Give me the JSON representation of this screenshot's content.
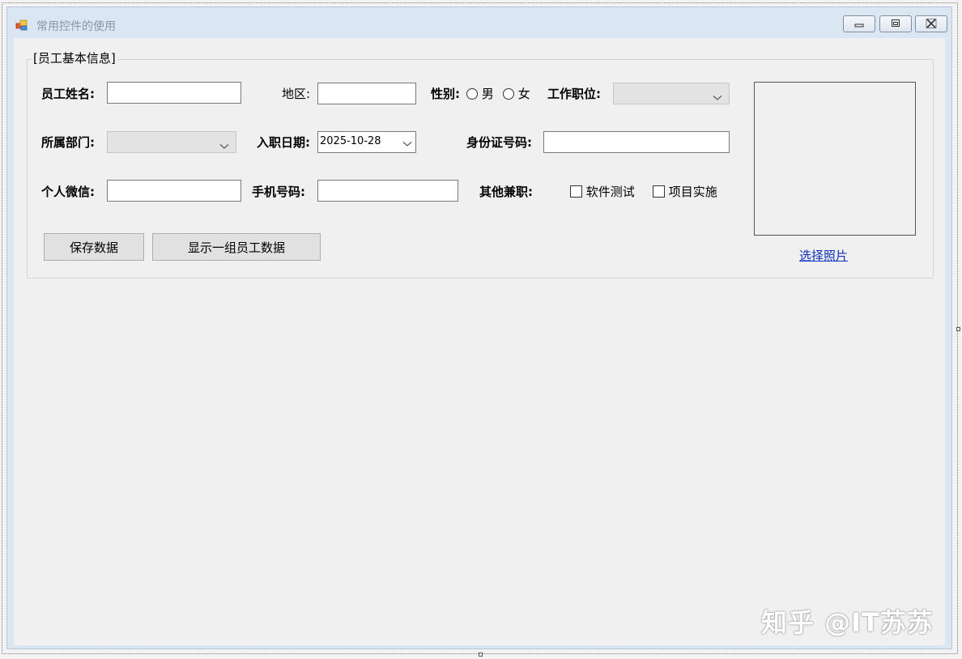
{
  "window": {
    "title": "常用控件的使用"
  },
  "group": {
    "title": "[员工基本信息]"
  },
  "form": {
    "name_label": "员工姓名:",
    "name_value": "",
    "region_label": "地区:",
    "region_value": "",
    "gender_label": "性别:",
    "gender_options": [
      "男",
      "女"
    ],
    "position_label": "工作职位:",
    "position_value": "",
    "dept_label": "所属部门:",
    "dept_value": "",
    "hire_date_label": "入职日期:",
    "hire_date_value": "2025-10-28",
    "id_label": "身份证号码:",
    "id_value": "",
    "wechat_label": "个人微信:",
    "wechat_value": "",
    "phone_label": "手机号码:",
    "phone_value": "",
    "other_jobs_label": "其他兼职:",
    "other_jobs_options": [
      "软件测试",
      "项目实施"
    ]
  },
  "buttons": {
    "save": "保存数据",
    "show_group": "显示一组员工数据"
  },
  "photo": {
    "link_label": "选择照片"
  },
  "watermark": "知乎 @IT苏苏"
}
